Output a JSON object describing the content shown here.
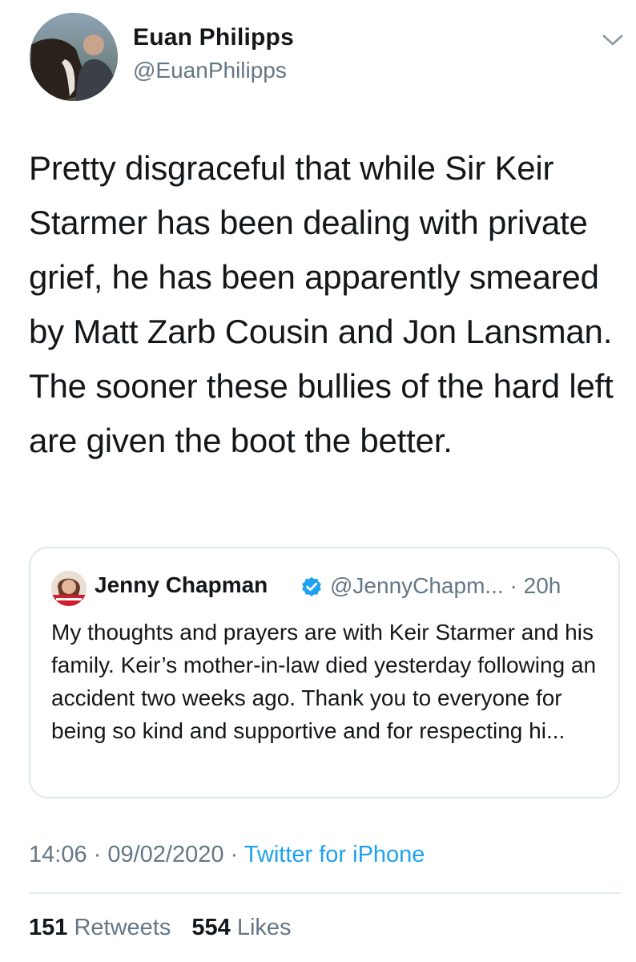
{
  "author": {
    "name": "Euan Philipps",
    "handle": "@EuanPhilipps"
  },
  "tweet": {
    "text": "Pretty disgraceful that while Sir Keir Starmer has been dealing with private grief, he has been apparently smeared by Matt Zarb Cousin and Jon Lansman. The sooner these bullies of the hard left are given the boot the better."
  },
  "quoted_tweet": {
    "name": "Jenny Chapman",
    "handle": "@JennyChapm...",
    "separator": " · ",
    "age": "20h",
    "verified": true,
    "text": "My thoughts and prayers are with Keir Starmer and his family. Keir’s mother-in-law died yesterday following an accident two weeks ago. Thank you to everyone for being so kind and supportive and for respecting hi..."
  },
  "meta": {
    "time": "14:06",
    "separator": " · ",
    "date": "09/02/2020",
    "source": "Twitter for iPhone"
  },
  "stats": {
    "retweets_count": "151",
    "retweets_label": "Retweets",
    "likes_count": "554",
    "likes_label": "Likes"
  },
  "icons": {
    "menu": "chevron-down-icon",
    "verified": "verified-badge-icon"
  },
  "colors": {
    "link": "#1da1f2",
    "secondary_text": "#657786",
    "primary_text": "#14171a",
    "border": "#e1e8ed"
  }
}
